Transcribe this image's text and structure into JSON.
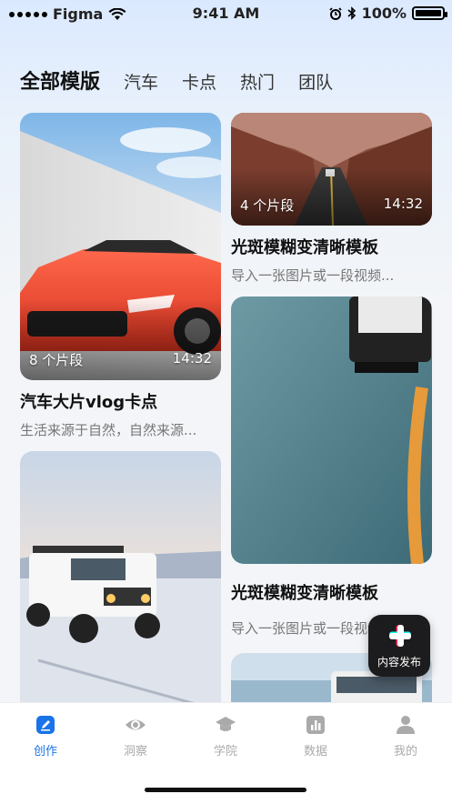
{
  "status": {
    "carrier": "Figma",
    "time": "9:41 AM",
    "battery": "100%",
    "battery_level": 1.0
  },
  "tabs": [
    {
      "label": "全部模版",
      "active": true
    },
    {
      "label": "汽车",
      "active": false
    },
    {
      "label": "卡点",
      "active": false
    },
    {
      "label": "热门",
      "active": false
    },
    {
      "label": "团队",
      "active": false
    }
  ],
  "cards": [
    {
      "clips": "8 个片段",
      "duration": "14:32",
      "title": "汽车大片vlog卡点",
      "desc": "生活来源于自然，自然来源..."
    },
    {
      "clips": "4 个片段",
      "duration": "14:32",
      "title": "光斑模糊变清晰模板",
      "desc": "导入一张图片或一段视频..."
    },
    {
      "title": "光斑模糊变清晰模板",
      "desc": "导入一张图片或一段视频..."
    }
  ],
  "fab": {
    "label": "内容发布"
  },
  "nav": [
    {
      "label": "创作",
      "icon": "pen-icon",
      "active": true
    },
    {
      "label": "洞察",
      "icon": "eye-icon",
      "active": false
    },
    {
      "label": "学院",
      "icon": "graduation-cap-icon",
      "active": false
    },
    {
      "label": "数据",
      "icon": "bar-chart-icon",
      "active": false
    },
    {
      "label": "我的",
      "icon": "person-icon",
      "active": false
    }
  ],
  "colors": {
    "accent": "#1a73e8",
    "inactive": "#aaaaaa",
    "fab_bg": "#1c1c1e"
  }
}
